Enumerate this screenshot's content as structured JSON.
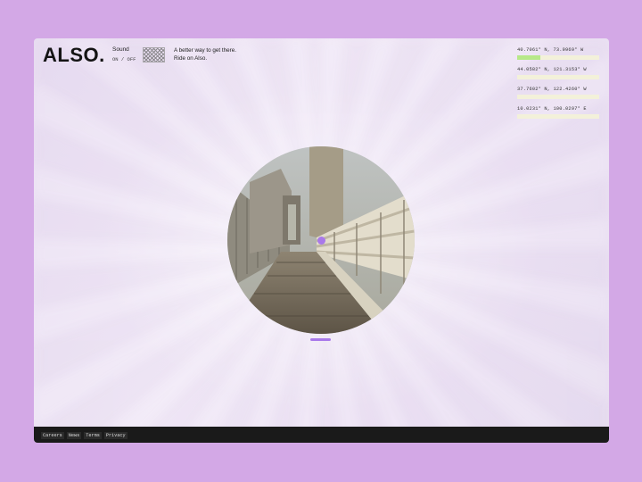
{
  "brand": {
    "logo": "ALSO."
  },
  "sound": {
    "label": "Sound",
    "on": "ON",
    "separator": "/",
    "off": "OFF"
  },
  "tagline": {
    "line1": "A better way to get there.",
    "line2": "Ride on Also."
  },
  "coordinates": [
    {
      "text": "40.7061° N,  73.9969° W",
      "progress": 0.28
    },
    {
      "text": "44.0582° N,  121.3153° W",
      "progress": 0
    },
    {
      "text": "37.7602° N,  122.4260° W",
      "progress": 0
    },
    {
      "text": "10.0231° N,  100.0297° E",
      "progress": 0
    }
  ],
  "video": {
    "scene": "bridge pedestrian walkway"
  },
  "footer": {
    "links": [
      "Careers",
      "News",
      "Terms",
      "Privacy"
    ]
  },
  "colors": {
    "outer_background": "#d3a8e6",
    "accent": "#a979ea",
    "progress_fill": "#b7e889",
    "progress_track": "#f3f1da",
    "footer": "#1a1a1a"
  }
}
